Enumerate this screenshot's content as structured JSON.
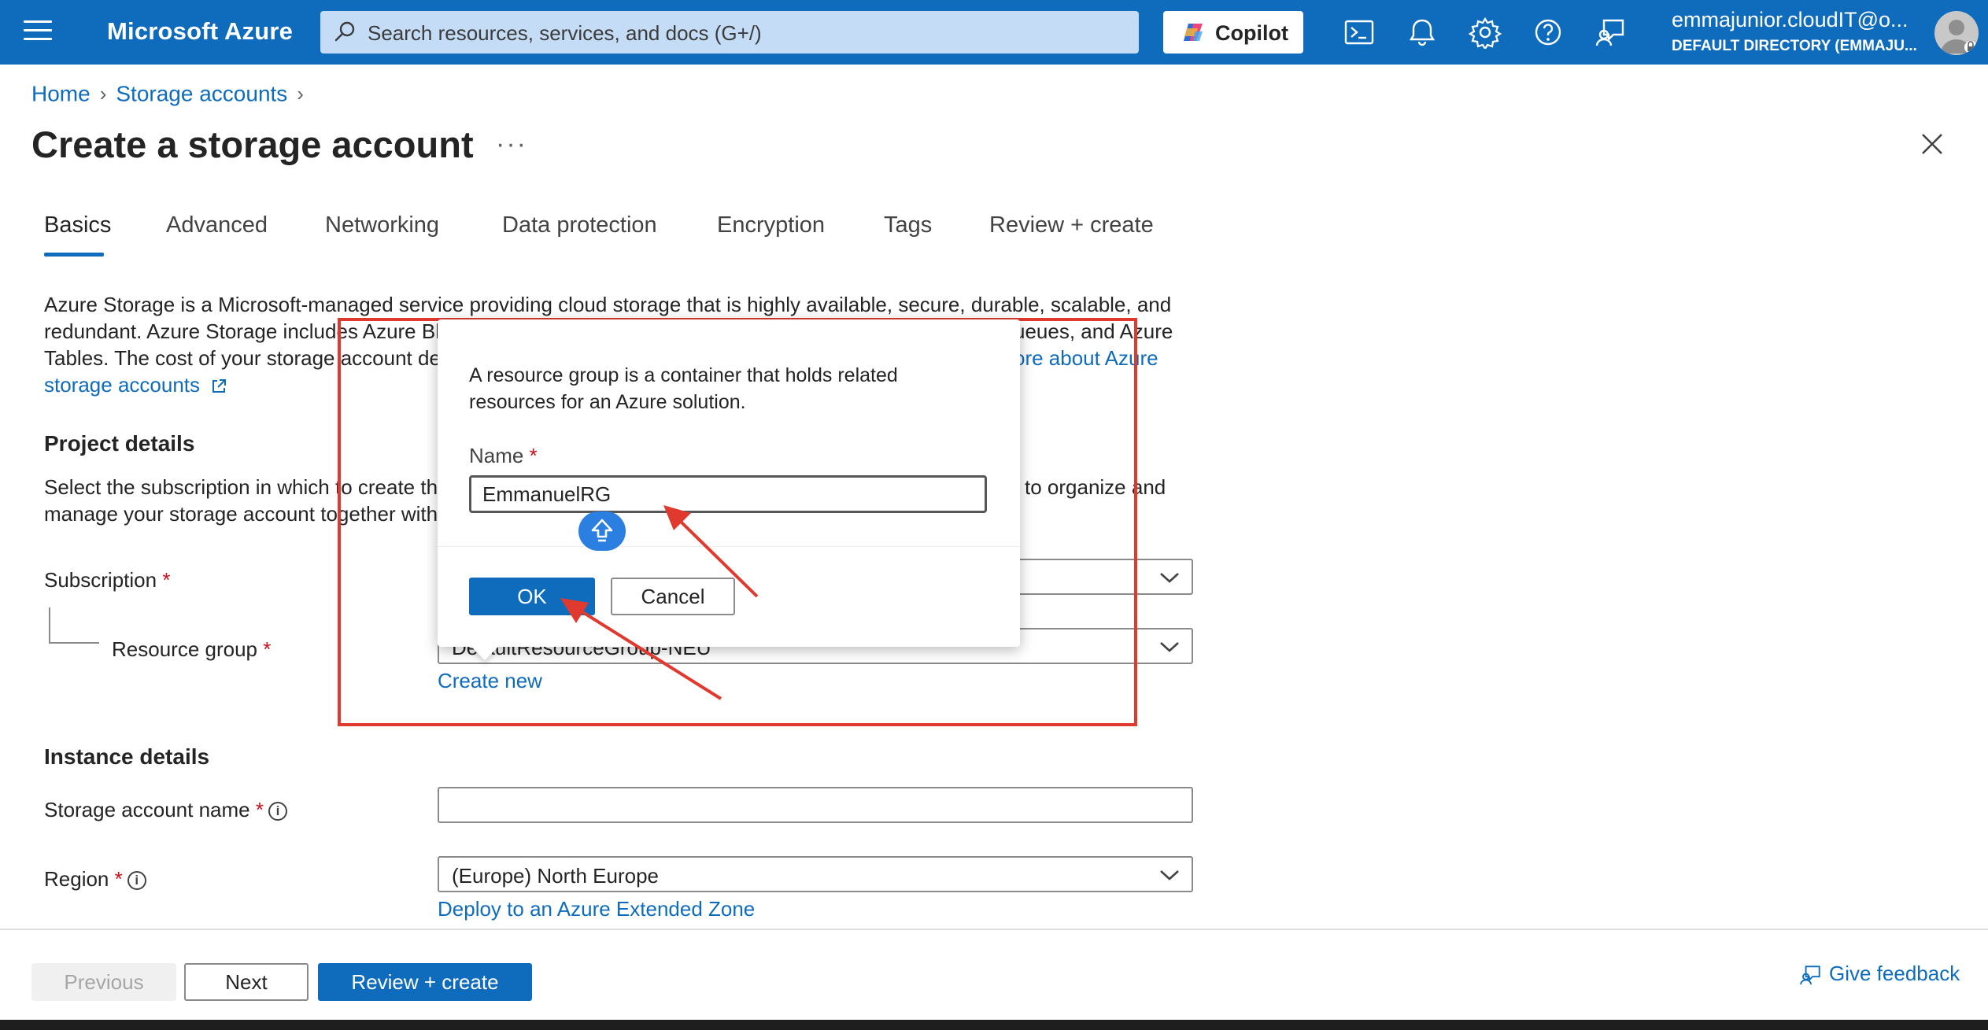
{
  "topbar": {
    "brand": "Microsoft Azure",
    "search_placeholder": "Search resources, services, and docs (G+/)",
    "copilot_label": "Copilot",
    "account_name": "emmajunior.cloudIT@o...",
    "account_directory": "DEFAULT DIRECTORY (EMMAJU..."
  },
  "breadcrumb": {
    "home": "Home",
    "storage_accounts": "Storage accounts"
  },
  "page": {
    "title": "Create a storage account",
    "more": "···"
  },
  "tabs": [
    "Basics",
    "Advanced",
    "Networking",
    "Data protection",
    "Encryption",
    "Tags",
    "Review + create"
  ],
  "intro": {
    "line1": "Azure Storage is a Microsoft-managed service providing cloud storage that is highly available, secure, durable, scalable, and",
    "line2a": "redundant. Azure Storage includes Azure Bl",
    "line2b": "ueues, and Azure",
    "line3a": "Tables. The cost of your storage account dep",
    "line3b": "ore about Azure",
    "line4": "storage accounts"
  },
  "project": {
    "heading": "Project details",
    "para_line1a": "Select the subscription in which to create th",
    "para_line1b": "to organize and",
    "para_line2": "manage your storage account together with",
    "subscription_label": "Subscription",
    "resource_group_label": "Resource group",
    "resource_group_value": "DefaultResourceGroup-NEU",
    "create_new": "Create new",
    "required_mark": "*"
  },
  "instance": {
    "heading": "Instance details",
    "storage_name_label": "Storage account name",
    "storage_name_value": "",
    "region_label": "Region",
    "region_value": "(Europe) North Europe",
    "extended_zone_link": "Deploy to an Azure Extended Zone",
    "info_glyph": "i"
  },
  "callout": {
    "description": "A resource group is a container that holds related resources for an Azure solution.",
    "name_label": "Name",
    "name_value": "EmmanuelRG",
    "ok_label": "OK",
    "cancel_label": "Cancel"
  },
  "footer": {
    "previous_label": "Previous",
    "next_label": "Next",
    "review_label": "Review + create",
    "feedback_label": "Give feedback"
  },
  "colors": {
    "azure_blue": "#0f6cbd",
    "annotation_red": "#e03a2f",
    "required_red": "#c50f1f"
  },
  "icons": [
    "hamburger-icon",
    "search-icon",
    "copilot-icon",
    "cloud-shell-icon",
    "bell-icon",
    "gear-icon",
    "help-icon",
    "feedback-icon",
    "avatar",
    "close-icon",
    "external-link-icon",
    "chevron-down-icon",
    "info-icon",
    "shift-key-icon"
  ]
}
